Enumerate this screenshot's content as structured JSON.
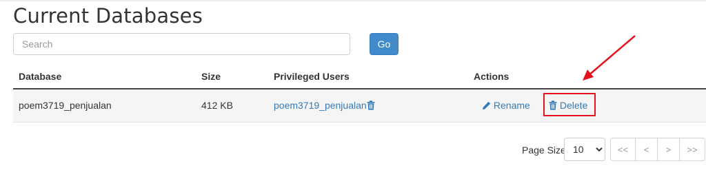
{
  "page": {
    "title": "Current Databases"
  },
  "search": {
    "placeholder": "Search",
    "value": "",
    "go_label": "Go"
  },
  "table": {
    "columns": [
      "Database",
      "Size",
      "Privileged Users",
      "Actions"
    ],
    "rows": [
      {
        "database": "poem3719_penjualan",
        "size": "412 KB",
        "privileged_user": "poem3719_penjualan",
        "actions": {
          "rename": "Rename",
          "delete": "Delete"
        }
      }
    ]
  },
  "pagination": {
    "page_size_label": "Page Size",
    "page_size_value": "10",
    "page_size_options": [
      "10"
    ],
    "buttons": [
      "<<",
      "<",
      ">",
      ">>"
    ]
  },
  "colors": {
    "accent": "#428bca",
    "link": "#337ab7",
    "annotation": "#e3121b"
  },
  "icons": {
    "rename": "pencil-icon",
    "delete": "trash-icon",
    "user_delete": "trash-icon"
  }
}
